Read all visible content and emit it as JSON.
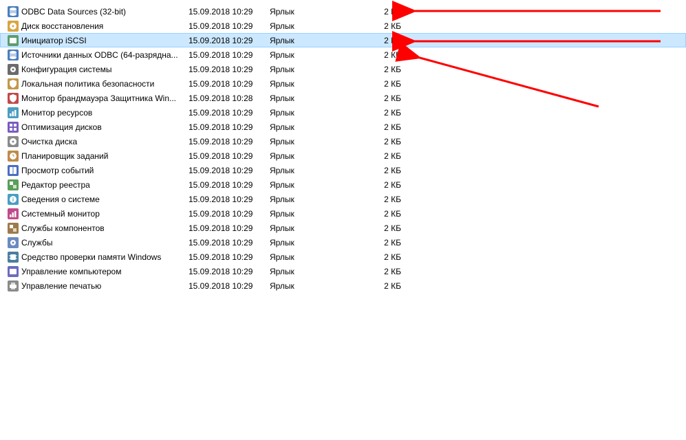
{
  "files": [
    {
      "icon": "odbc-dsn-icon",
      "name": "ODBC Data Sources (32-bit)",
      "date": "15.09.2018 10:29",
      "type": "Ярлык",
      "size": "2 КБ",
      "selected": false
    },
    {
      "icon": "recovery-disk-icon",
      "name": "Диск восстановления",
      "date": "15.09.2018 10:29",
      "type": "Ярлык",
      "size": "2 КБ",
      "selected": false
    },
    {
      "icon": "iscsi-icon",
      "name": "Инициатор iSCSI",
      "date": "15.09.2018 10:29",
      "type": "Ярлык",
      "size": "2 КБ",
      "selected": true
    },
    {
      "icon": "odbc-dsn-icon",
      "name": "Источники данных ODBC (64-разрядна...",
      "date": "15.09.2018 10:29",
      "type": "Ярлык",
      "size": "2 КБ",
      "selected": false
    },
    {
      "icon": "system-config-icon",
      "name": "Конфигурация системы",
      "date": "15.09.2018 10:29",
      "type": "Ярлык",
      "size": "2 КБ",
      "selected": false
    },
    {
      "icon": "local-security-icon",
      "name": "Локальная политика безопасности",
      "date": "15.09.2018 10:29",
      "type": "Ярлык",
      "size": "2 КБ",
      "selected": false
    },
    {
      "icon": "firewall-monitor-icon",
      "name": "Монитор брандмауэра Защитника Win...",
      "date": "15.09.2018 10:28",
      "type": "Ярлык",
      "size": "2 КБ",
      "selected": false
    },
    {
      "icon": "resource-monitor-icon",
      "name": "Монитор ресурсов",
      "date": "15.09.2018 10:29",
      "type": "Ярлык",
      "size": "2 КБ",
      "selected": false
    },
    {
      "icon": "defrag-icon",
      "name": "Оптимизация дисков",
      "date": "15.09.2018 10:29",
      "type": "Ярлык",
      "size": "2 КБ",
      "selected": false
    },
    {
      "icon": "disk-cleanup-icon",
      "name": "Очистка диска",
      "date": "15.09.2018 10:29",
      "type": "Ярлык",
      "size": "2 КБ",
      "selected": false
    },
    {
      "icon": "task-scheduler-icon",
      "name": "Планировщик заданий",
      "date": "15.09.2018 10:29",
      "type": "Ярлык",
      "size": "2 КБ",
      "selected": false
    },
    {
      "icon": "event-viewer-icon",
      "name": "Просмотр событий",
      "date": "15.09.2018 10:29",
      "type": "Ярлык",
      "size": "2 КБ",
      "selected": false
    },
    {
      "icon": "registry-editor-icon",
      "name": "Редактор реестра",
      "date": "15.09.2018 10:29",
      "type": "Ярлык",
      "size": "2 КБ",
      "selected": false
    },
    {
      "icon": "system-info-icon",
      "name": "Сведения о системе",
      "date": "15.09.2018 10:29",
      "type": "Ярлык",
      "size": "2 КБ",
      "selected": false
    },
    {
      "icon": "perfmon-icon",
      "name": "Системный монитор",
      "date": "15.09.2018 10:29",
      "type": "Ярлык",
      "size": "2 КБ",
      "selected": false
    },
    {
      "icon": "component-services-icon",
      "name": "Службы компонентов",
      "date": "15.09.2018 10:29",
      "type": "Ярлык",
      "size": "2 КБ",
      "selected": false
    },
    {
      "icon": "services-icon",
      "name": "Службы",
      "date": "15.09.2018 10:29",
      "type": "Ярлык",
      "size": "2 КБ",
      "selected": false
    },
    {
      "icon": "memory-diag-icon",
      "name": "Средство проверки памяти Windows",
      "date": "15.09.2018 10:29",
      "type": "Ярлык",
      "size": "2 КБ",
      "selected": false
    },
    {
      "icon": "computer-mgmt-icon",
      "name": "Управление компьютером",
      "date": "15.09.2018 10:29",
      "type": "Ярлык",
      "size": "2 КБ",
      "selected": false
    },
    {
      "icon": "print-mgmt-icon",
      "name": "Управление печатью",
      "date": "15.09.2018 10:29",
      "type": "Ярлык",
      "size": "2 КБ",
      "selected": false
    }
  ]
}
